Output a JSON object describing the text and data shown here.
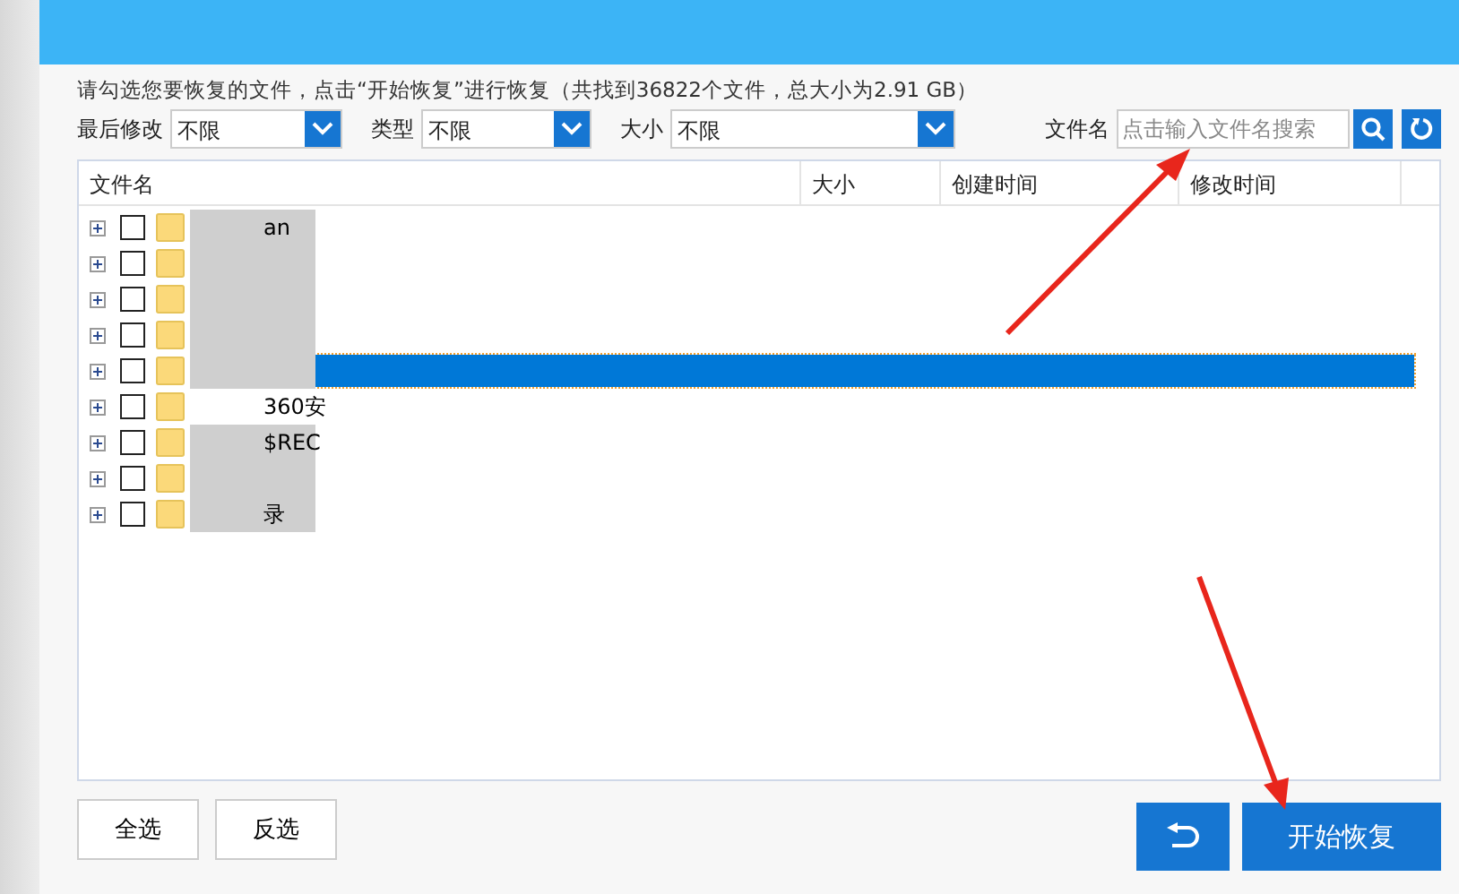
{
  "notice": "请勾选您要恢复的文件，点击“开始恢复”进行恢复（共找到36822个文件，总大小为2.91 GB）",
  "filters": [
    {
      "label": "最后修改",
      "value": "不限"
    },
    {
      "label": "类型",
      "value": "不限"
    },
    {
      "label": "大小",
      "value": "不限"
    }
  ],
  "search": {
    "label": "文件名",
    "placeholder": "点击输入文件名搜索"
  },
  "table": {
    "columns": [
      "文件名",
      "大小",
      "创建时间",
      "修改时间"
    ],
    "rows": [
      {
        "name": "an",
        "checked": false,
        "selected": false,
        "blurred": true
      },
      {
        "name": "",
        "checked": false,
        "selected": false,
        "blurred": true
      },
      {
        "name": "",
        "checked": false,
        "selected": false,
        "blurred": true
      },
      {
        "name": "",
        "checked": false,
        "selected": false,
        "blurred": true
      },
      {
        "name": "",
        "checked": false,
        "selected": true,
        "blurred": true
      },
      {
        "name": "360安",
        "checked": false,
        "selected": false,
        "blurred": false
      },
      {
        "name": "$REC",
        "checked": false,
        "selected": false,
        "blurred": true
      },
      {
        "name": "",
        "checked": false,
        "selected": false,
        "blurred": true
      },
      {
        "name": "录",
        "checked": false,
        "selected": false,
        "blurred": true
      }
    ]
  },
  "buttons": [
    "全选",
    "反选"
  ],
  "start_button": "开始恢复"
}
